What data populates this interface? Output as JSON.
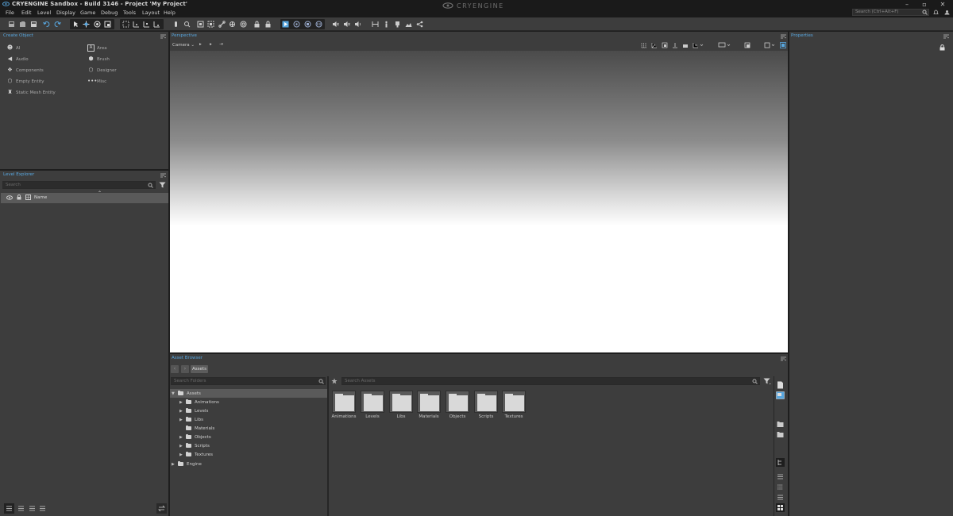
{
  "window": {
    "title": "CRYENGINE Sandbox - Build 3146 - Project 'My Project'",
    "logo_text": "CRYENGINE",
    "controls": [
      "–",
      "▫",
      "✕"
    ]
  },
  "menu": {
    "items": [
      "File",
      "Edit",
      "Level",
      "Display",
      "Game",
      "Debug",
      "Tools",
      "Layout",
      "Help"
    ],
    "search_placeholder": "Search (Ctrl+Alt+F)"
  },
  "create_object": {
    "title": "Create Object",
    "items": [
      {
        "label": "AI",
        "icon": "ai-icon"
      },
      {
        "label": "Area",
        "icon": "area-icon"
      },
      {
        "label": "Audio",
        "icon": "audio-icon"
      },
      {
        "label": "Brush",
        "icon": "brush-icon"
      },
      {
        "label": "Components",
        "icon": "components-icon"
      },
      {
        "label": "Designer",
        "icon": "designer-icon"
      },
      {
        "label": "Empty Entity",
        "icon": "empty-entity-icon"
      },
      {
        "label": "Misc",
        "icon": "misc-icon"
      },
      {
        "label": "Static Mesh Entity",
        "icon": "static-mesh-icon"
      }
    ]
  },
  "level_explorer": {
    "title": "Level Explorer",
    "search_placeholder": "Search",
    "column_name": "Name"
  },
  "perspective": {
    "title": "Perspective",
    "camera_label": "Camera"
  },
  "properties": {
    "title": "Properties"
  },
  "asset_browser": {
    "title": "Asset Browser",
    "breadcrumb": "Assets",
    "folder_search_placeholder": "Search Folders",
    "asset_search_placeholder": "Search Assets",
    "tree": [
      {
        "label": "Assets",
        "level": 0,
        "expanded": true
      },
      {
        "label": "Animations",
        "level": 1
      },
      {
        "label": "Levels",
        "level": 1
      },
      {
        "label": "Libs",
        "level": 1
      },
      {
        "label": "Materials",
        "level": 1
      },
      {
        "label": "Objects",
        "level": 1
      },
      {
        "label": "Scripts",
        "level": 1
      },
      {
        "label": "Textures",
        "level": 1
      },
      {
        "label": "Engine",
        "level": 0
      }
    ],
    "tiles": [
      "Animations",
      "Levels",
      "Libs",
      "Materials",
      "Objects",
      "Scripts",
      "Textures"
    ]
  },
  "colors": {
    "accent": "#58a6de",
    "panel": "#3d3d3d",
    "background": "#1e1e1e"
  }
}
